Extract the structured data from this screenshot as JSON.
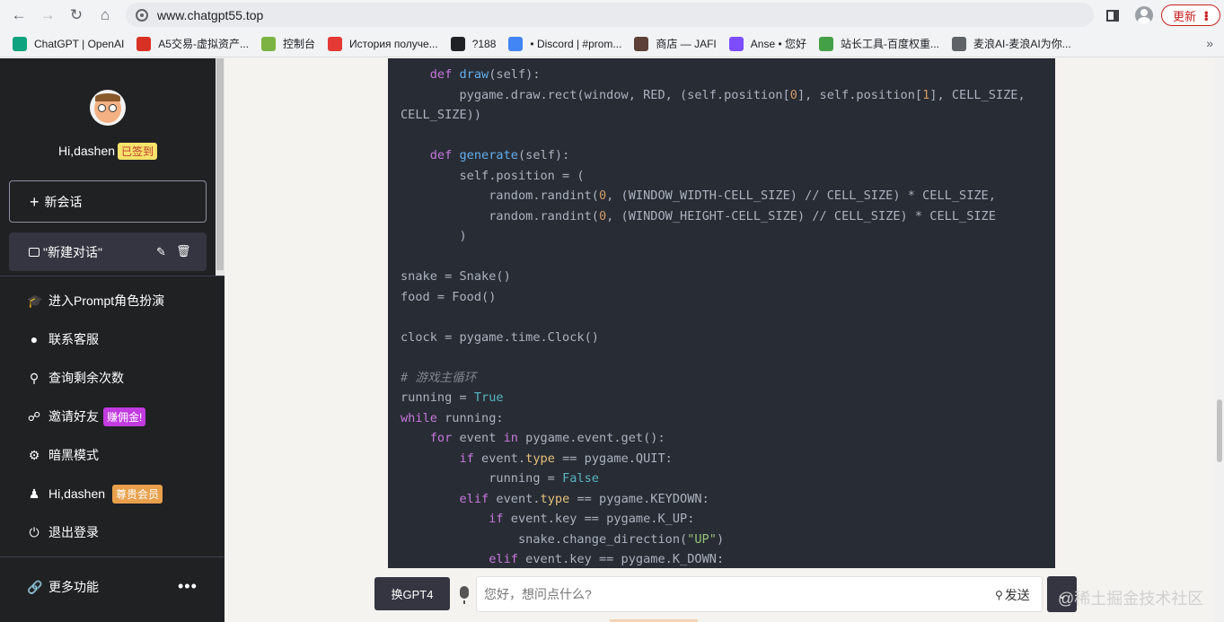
{
  "browser": {
    "url": "www.chatgpt55.top",
    "update_label": "更新",
    "bookmarks": [
      {
        "label": "ChatGPT | OpenAI",
        "color": "#10a37f"
      },
      {
        "label": "A5交易-虚拟资产...",
        "color": "#d93025"
      },
      {
        "label": "控制台",
        "color": "#7cb342"
      },
      {
        "label": "История получе...",
        "color": "#e53935"
      },
      {
        "label": "?188",
        "color": "#202124"
      },
      {
        "label": "• Discord | #prom...",
        "color": "#4285f4"
      },
      {
        "label": "商店 — JAFI",
        "color": "#5d4037"
      },
      {
        "label": "Anse • 您好",
        "color": "#7c4dff"
      },
      {
        "label": "站长工具-百度权重...",
        "color": "#43a047"
      },
      {
        "label": "麦浪AI-麦浪AI为你...",
        "color": "#5f6368"
      }
    ]
  },
  "sidebar": {
    "greeting": "Hi,dashen",
    "signed_badge": "已签到",
    "new_chat_label": "新会话",
    "conversation_title": "\"新建对话\"",
    "menu": {
      "prompt": "进入Prompt角色扮演",
      "support": "联系客服",
      "remaining": "查询剩余次数",
      "invite": "邀请好友",
      "invite_tag": "赚佣金!",
      "dark_mode": "暗黑模式",
      "user": "Hi,dashen",
      "vip_tag": "尊贵会员",
      "logout": "退出登录",
      "more": "更多功能"
    }
  },
  "code_lines": [
    "    def draw(self):",
    "        pygame.draw.rect(window, RED, (self.position[0], self.position[1], CELL_SIZE,",
    "CELL_SIZE))",
    "",
    "    def generate(self):",
    "        self.position = (",
    "            random.randint(0, (WINDOW_WIDTH-CELL_SIZE) // CELL_SIZE) * CELL_SIZE,",
    "            random.randint(0, (WINDOW_HEIGHT-CELL_SIZE) // CELL_SIZE) * CELL_SIZE",
    "        )",
    "",
    "snake = Snake()",
    "food = Food()",
    "",
    "clock = pygame.time.Clock()",
    "",
    "# 游戏主循环",
    "running = True",
    "while running:",
    "    for event in pygame.event.get():",
    "        if event.type == pygame.QUIT:",
    "            running = False",
    "        elif event.type == pygame.KEYDOWN:",
    "            if event.key == pygame.K_UP:",
    "                snake.change_direction(\"UP\")",
    "            elif event.key == pygame.K_DOWN:"
  ],
  "input": {
    "gpt4_label": "换GPT4",
    "placeholder": "您好，想问点什么?",
    "send_label": "发送"
  },
  "watermark": "@稀土掘金技术社区"
}
